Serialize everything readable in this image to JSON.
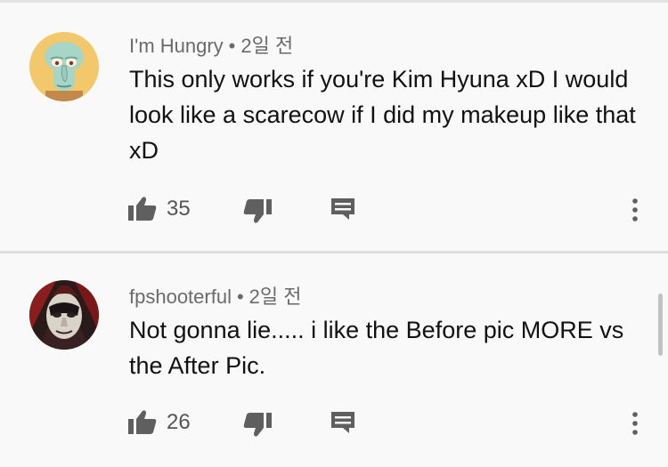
{
  "comments": [
    {
      "author": "I'm Hungry",
      "separator": "•",
      "time": "2일 전",
      "text": "This only works if you're Kim Hyuna xD I would look like a scarecow if I did my makeup like that xD",
      "likes": "35",
      "avatar_icon": "squidward-avatar"
    },
    {
      "author": "fpshooterful",
      "separator": "•",
      "time": "2일 전",
      "text": "Not gonna lie..... i like the Before pic MORE vs the After Pic.",
      "likes": "26",
      "avatar_icon": "masked-face-avatar"
    }
  ],
  "colors": {
    "background": "#f9f9f9",
    "meta_text": "#6a6a6a",
    "icon": "#5f5f5f"
  }
}
